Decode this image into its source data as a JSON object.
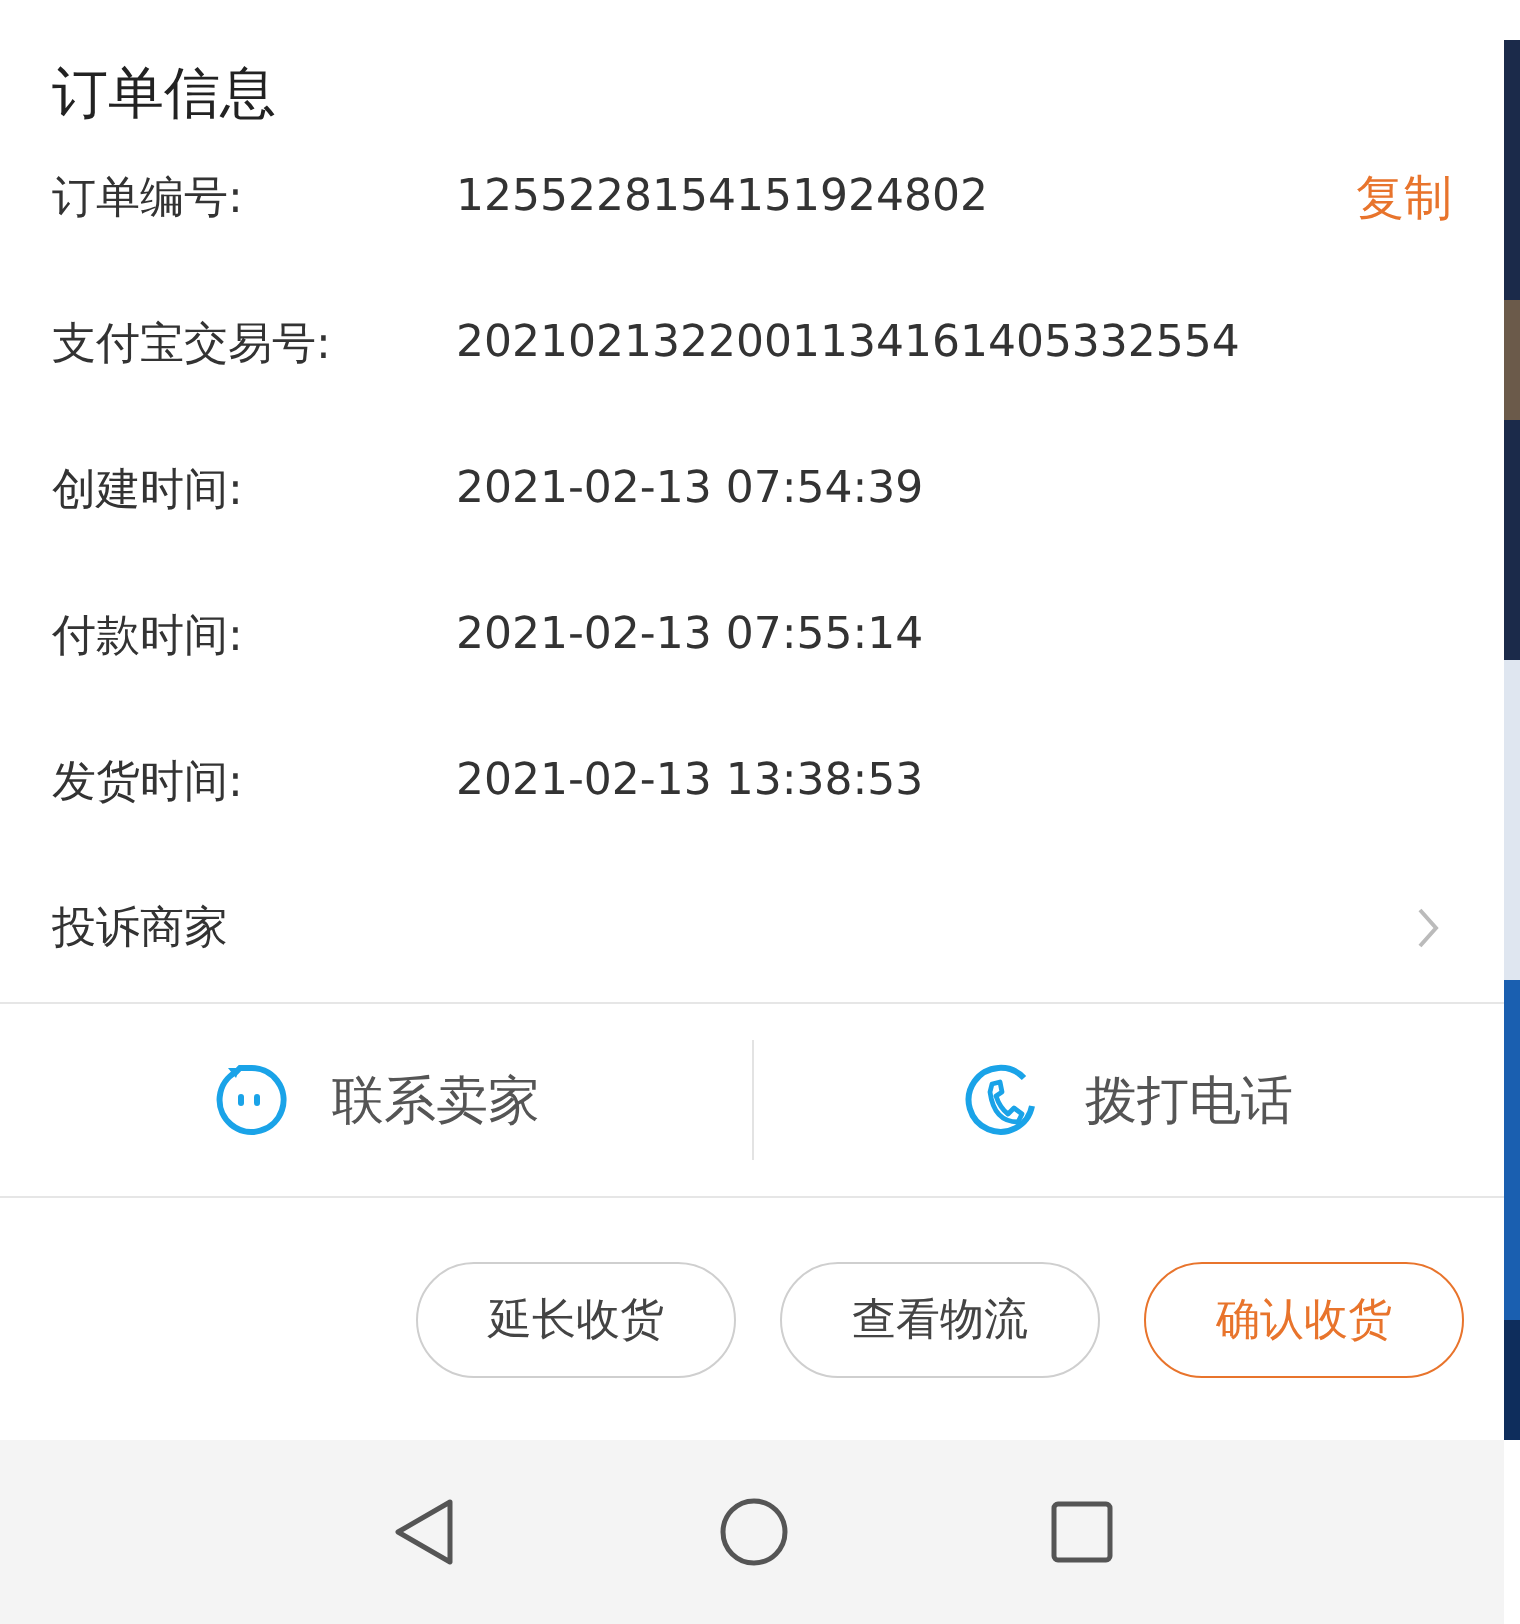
{
  "title": "订单信息",
  "fields": [
    {
      "label": "订单编号:",
      "value": "1255228154151924802",
      "action": "复制"
    },
    {
      "label": "支付宝交易号:",
      "value": "2021021322001134161405332554"
    },
    {
      "label": "创建时间:",
      "value": "2021-02-13 07:54:39"
    },
    {
      "label": "付款时间:",
      "value": "2021-02-13 07:55:14"
    },
    {
      "label": "发货时间:",
      "value": "2021-02-13 13:38:53"
    }
  ],
  "complaint": {
    "label": "投诉商家"
  },
  "contacts": [
    {
      "kind": "chat",
      "label": "联系卖家"
    },
    {
      "kind": "phone",
      "label": "拨打电话"
    }
  ],
  "buttons": [
    {
      "label": "延长收货",
      "primary": false
    },
    {
      "label": "查看物流",
      "primary": false
    },
    {
      "label": "确认收货",
      "primary": true
    }
  ],
  "nav": [
    {
      "kind": "back"
    },
    {
      "kind": "home"
    },
    {
      "kind": "recent"
    }
  ]
}
